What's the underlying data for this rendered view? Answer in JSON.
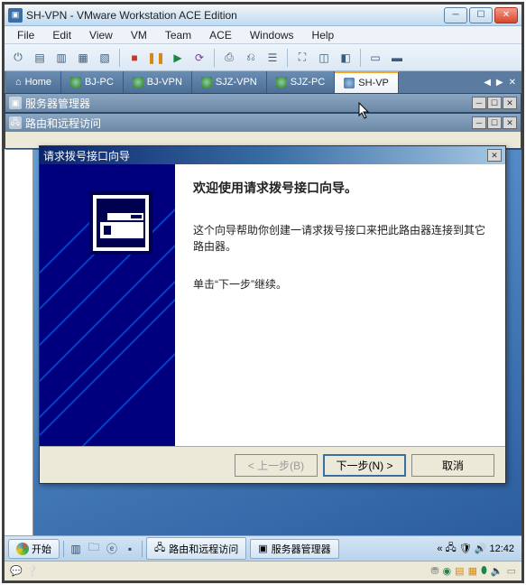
{
  "window": {
    "title": "SH-VPN - VMware Workstation ACE Edition",
    "min": "─",
    "max": "☐",
    "close": "✕"
  },
  "menu": [
    "File",
    "Edit",
    "View",
    "VM",
    "Team",
    "ACE",
    "Windows",
    "Help"
  ],
  "tabs": {
    "items": [
      {
        "label": "Home"
      },
      {
        "label": "BJ-PC"
      },
      {
        "label": "BJ-VPN"
      },
      {
        "label": "SJZ-VPN"
      },
      {
        "label": "SJZ-PC"
      },
      {
        "label": "SH-VP"
      }
    ],
    "active": 5
  },
  "mdi": {
    "server_mgr": "服务器管理器",
    "rras": "路由和远程访问"
  },
  "wizard": {
    "title": "请求拨号接口向导",
    "heading": "欢迎使用请求拨号接口向导。",
    "para1": "这个向导帮助你创建一请求拨号接口来把此路由器连接到其它路由器。",
    "para2": "单击“下一步”继续。",
    "back": "< 上一步(B)",
    "next": "下一步(N) >",
    "cancel": "取消"
  },
  "taskbar": {
    "start": "开始",
    "task1": "路由和远程访问",
    "task2": "服务器管理器",
    "time": "12:42"
  },
  "tree": {
    "root": "⊟"
  }
}
